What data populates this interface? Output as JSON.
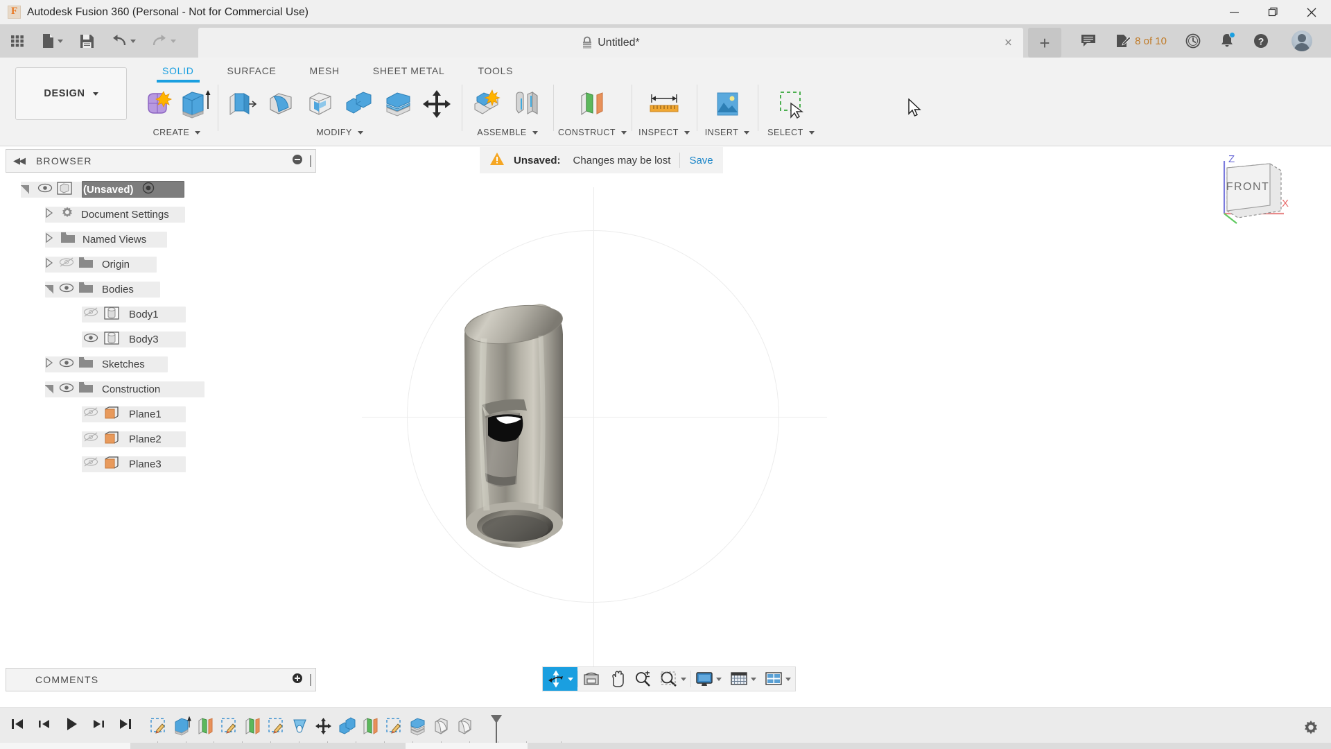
{
  "window": {
    "app_title": "Autodesk Fusion 360 (Personal - Not for Commercial Use)",
    "logo_letter": "F",
    "minimize": "minimize-icon",
    "maximize": "restore-icon",
    "close": "close-icon"
  },
  "quick_access": {
    "items": [
      {
        "name": "app-grid-button",
        "icon": "grid-icon"
      },
      {
        "name": "new-file-button",
        "icon": "file-icon",
        "has_caret": true
      },
      {
        "name": "save-button",
        "icon": "floppy-disk-icon"
      },
      {
        "name": "undo-button",
        "icon": "undo-arrow-icon",
        "has_caret": true
      },
      {
        "name": "redo-button",
        "icon": "redo-arrow-icon",
        "has_caret": true
      }
    ]
  },
  "document_tab": {
    "title": "Untitled*",
    "lock_icon": "lock-icon",
    "close_label": "×",
    "new_tab_label": "+"
  },
  "title_right": {
    "comment_icon": "comment-bubble-icon",
    "docs_icon": "document-edit-icon",
    "docs_count": "8 of 10",
    "history_icon": "clock-icon",
    "notifications_icon": "bell-icon",
    "help_icon": "question-mark-icon",
    "account_icon": "user-avatar"
  },
  "ribbon": {
    "workspace_label": "DESIGN",
    "tabs": [
      {
        "label": "SOLID",
        "active": true
      },
      {
        "label": "SURFACE",
        "active": false
      },
      {
        "label": "MESH",
        "active": false
      },
      {
        "label": "SHEET METAL",
        "active": false
      },
      {
        "label": "TOOLS",
        "active": false
      }
    ],
    "groups": [
      {
        "label": "CREATE",
        "icons": [
          "new-component-icon",
          "extrude-icon"
        ]
      },
      {
        "label": "MODIFY",
        "icons": [
          "press-pull-icon",
          "fillet-icon",
          "shell-icon",
          "combine-icon",
          "split-face-icon",
          "move-copy-icon"
        ]
      },
      {
        "label": "ASSEMBLE",
        "icons": [
          "new-component-assemble-icon",
          "joint-icon"
        ]
      },
      {
        "label": "CONSTRUCT",
        "icons": [
          "offset-plane-icon"
        ]
      },
      {
        "label": "INSPECT",
        "icons": [
          "measure-icon"
        ]
      },
      {
        "label": "INSERT",
        "icons": [
          "insert-image-icon"
        ]
      },
      {
        "label": "SELECT",
        "icons": [
          "select-window-icon"
        ]
      }
    ]
  },
  "browser": {
    "panel_title": "BROWSER",
    "collapse_icon": "collapse-left-icon",
    "minimize_icon": "minus-circle-icon",
    "tree": [
      {
        "label": "(Unsaved)",
        "indent": 0,
        "expander": "expanded",
        "eye": "visible",
        "icon": "document-cube-icon",
        "selected": true,
        "has_activate_dot": true
      },
      {
        "label": "Document Settings",
        "indent": 1,
        "expander": "collapsed",
        "eye": "none",
        "icon": "gear-icon",
        "selected": false
      },
      {
        "label": "Named Views",
        "indent": 1,
        "expander": "collapsed",
        "eye": "none",
        "icon": "folder-icon",
        "selected": false
      },
      {
        "label": "Origin",
        "indent": 1,
        "expander": "collapsed",
        "eye": "hidden",
        "icon": "folder-icon",
        "selected": false
      },
      {
        "label": "Bodies",
        "indent": 1,
        "expander": "expanded",
        "eye": "visible",
        "icon": "folder-icon",
        "selected": false
      },
      {
        "label": "Body1",
        "indent": 2,
        "expander": "none",
        "eye": "hidden",
        "icon": "body-cylinder-icon",
        "selected": false
      },
      {
        "label": "Body3",
        "indent": 2,
        "expander": "none",
        "eye": "visible",
        "icon": "body-cylinder-icon",
        "selected": false
      },
      {
        "label": "Sketches",
        "indent": 1,
        "expander": "collapsed",
        "eye": "visible",
        "icon": "folder-icon",
        "selected": false
      },
      {
        "label": "Construction",
        "indent": 1,
        "expander": "expanded",
        "eye": "visible",
        "icon": "folder-icon",
        "selected": false
      },
      {
        "label": "Plane1",
        "indent": 2,
        "expander": "none",
        "eye": "hidden",
        "icon": "plane-icon",
        "selected": false
      },
      {
        "label": "Plane2",
        "indent": 2,
        "expander": "none",
        "eye": "hidden",
        "icon": "plane-icon",
        "selected": false
      },
      {
        "label": "Plane3",
        "indent": 2,
        "expander": "none",
        "eye": "hidden",
        "icon": "plane-icon",
        "selected": false
      }
    ]
  },
  "canvas": {
    "unsaved_banner": {
      "warning_icon": "warning-triangle-icon",
      "label": "Unsaved:",
      "message": "Changes may be lost",
      "action": "Save"
    },
    "viewcube": {
      "face_label": "FRONT",
      "axis_z": "Z",
      "axis_x": "X"
    },
    "model": "metal-cylinder-with-slot"
  },
  "navbar": {
    "items": [
      {
        "name": "orbit-button",
        "icon": "orbit-icon",
        "active": true,
        "has_caret": true
      },
      {
        "name": "look-at-button",
        "icon": "look-at-icon",
        "active": false,
        "has_caret": false
      },
      {
        "name": "pan-button",
        "icon": "hand-pan-icon",
        "active": false,
        "has_caret": false
      },
      {
        "name": "zoom-button",
        "icon": "zoom-magnifier-icon",
        "active": false,
        "has_caret": false
      },
      {
        "name": "fit-button",
        "icon": "zoom-fit-icon",
        "active": false,
        "has_caret": true
      },
      {
        "name": "display-settings-button",
        "icon": "monitor-icon",
        "active": false,
        "has_caret": true
      },
      {
        "name": "grid-snaps-button",
        "icon": "grid-snap-icon",
        "active": false,
        "has_caret": true
      },
      {
        "name": "viewports-button",
        "icon": "viewports-icon",
        "active": false,
        "has_caret": true
      }
    ]
  },
  "comments": {
    "panel_title": "COMMENTS",
    "add_icon": "plus-circle-icon"
  },
  "timeline": {
    "play_controls": [
      {
        "name": "go-to-beginning-button",
        "icon": "skip-start-icon"
      },
      {
        "name": "step-back-button",
        "icon": "step-back-icon"
      },
      {
        "name": "play-button",
        "icon": "play-icon"
      },
      {
        "name": "step-forward-button",
        "icon": "step-forward-icon"
      },
      {
        "name": "go-to-end-button",
        "icon": "skip-end-icon"
      }
    ],
    "features": [
      {
        "name": "sketch-feature",
        "icon": "sketch-icon"
      },
      {
        "name": "extrude-feature",
        "icon": "extrude-icon"
      },
      {
        "name": "plane-feature",
        "icon": "plane-icon"
      },
      {
        "name": "sketch-feature",
        "icon": "sketch-icon"
      },
      {
        "name": "plane-feature",
        "icon": "plane-icon"
      },
      {
        "name": "sketch-feature",
        "icon": "sketch-icon"
      },
      {
        "name": "revolve-feature",
        "icon": "revolve-icon"
      },
      {
        "name": "move-feature",
        "icon": "move-copy-icon"
      },
      {
        "name": "combine-feature",
        "icon": "combine-icon"
      },
      {
        "name": "plane-feature",
        "icon": "plane-icon"
      },
      {
        "name": "sketch-feature",
        "icon": "sketch-icon"
      },
      {
        "name": "shell-feature",
        "icon": "shell-icon"
      },
      {
        "name": "fillet-feature",
        "icon": "fillet-icon"
      },
      {
        "name": "fillet-feature",
        "icon": "fillet-icon"
      }
    ],
    "settings_icon": "gear-icon"
  },
  "colors": {
    "accent_blue": "#1a9fe0",
    "warning_orange": "#f5a623",
    "link_blue": "#1a85c8",
    "titlebar_bg": "#f0f0f0",
    "toolbar_bg": "#d4d4d4",
    "ribbon_bg": "#f2f2f2"
  }
}
